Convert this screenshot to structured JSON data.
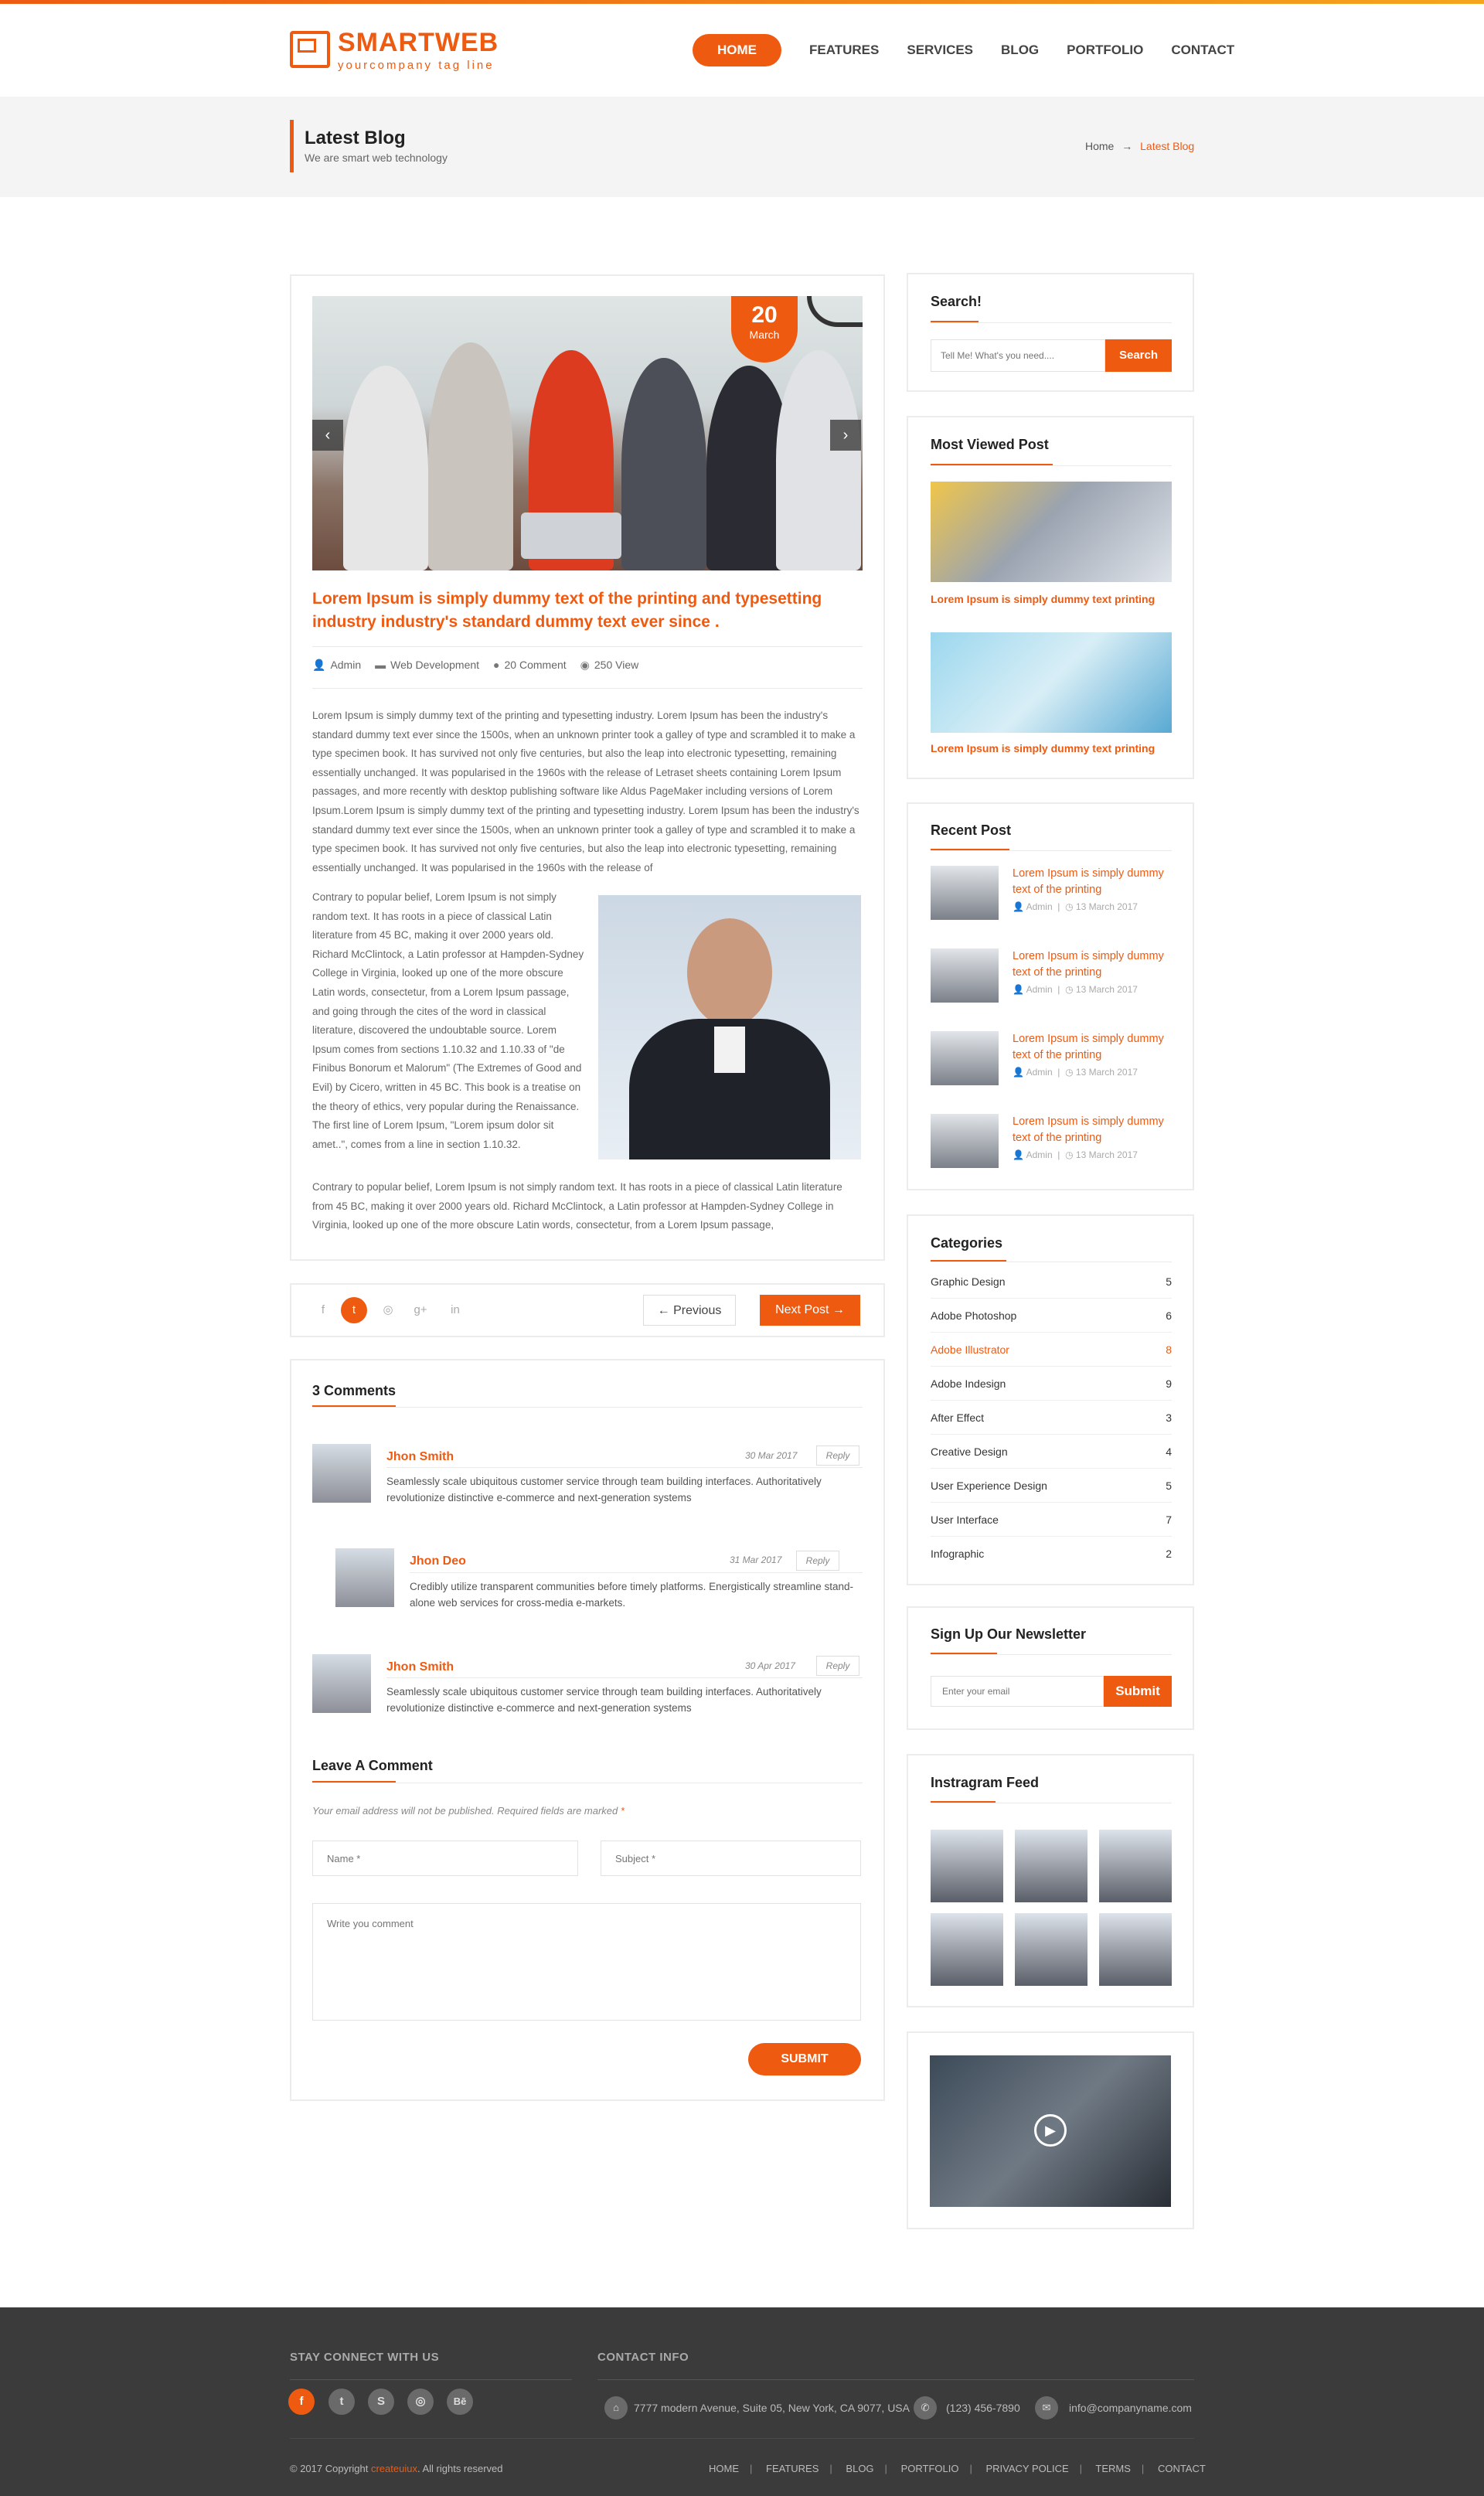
{
  "brand": {
    "name": "SMARTWEB",
    "tagline": "yourcompany tag line"
  },
  "nav": [
    "HOME",
    "FEATURES",
    "SERVICES",
    "BLOG",
    "PORTFOLIO",
    "CONTACT"
  ],
  "page": {
    "title": "Latest Blog",
    "subtitle": "We are smart web technology"
  },
  "breadcrumb": {
    "home": "Home",
    "current": "Latest Blog"
  },
  "post": {
    "date_day": "20",
    "date_month": "March",
    "title": "Lorem Ipsum is simply dummy text of the printing and typesetting industry industry's standard dummy text ever since .",
    "author": "Admin",
    "category": "Web Development",
    "comments": "20 Comment",
    "views": "250 View",
    "para1": "Lorem Ipsum is simply dummy text of the printing and typesetting industry. Lorem Ipsum has been the industry's standard dummy text ever since the 1500s, when an unknown printer took a galley of type and scrambled it to make a type specimen book. It has survived not only five centuries, but also the leap into electronic typesetting, remaining essentially unchanged. It was popularised in the 1960s with the release of Letraset sheets containing Lorem Ipsum passages, and more recently with desktop publishing software like Aldus PageMaker including versions of Lorem Ipsum.Lorem Ipsum is simply dummy text of the printing and typesetting industry. Lorem Ipsum has been the industry's standard dummy text ever since the 1500s, when an unknown printer took a galley of type and scrambled it to make a type specimen book. It has survived not only five centuries, but also the leap into electronic typesetting, remaining essentially unchanged. It was popularised in the 1960s with the release of",
    "para2": "Contrary to popular belief, Lorem Ipsum is not simply random text. It has roots in a piece of classical Latin literature from 45 BC, making it over 2000 years old. Richard McClintock, a Latin professor at Hampden-Sydney College in Virginia, looked up one of the more obscure Latin words, consectetur, from a Lorem Ipsum passage, and going through the cites of the word in classical literature, discovered the undoubtable source. Lorem Ipsum comes from sections 1.10.32 and 1.10.33 of \"de Finibus Bonorum et Malorum\" (The Extremes of Good and Evil) by Cicero, written in 45 BC. This book is a treatise on the theory of ethics, very popular during the Renaissance. The first line of Lorem Ipsum, \"Lorem ipsum dolor sit amet..\", comes from a line in section 1.10.32.",
    "para3": "Contrary to popular belief, Lorem Ipsum is not simply random text. It has roots in a piece of classical Latin literature from 45 BC, making it over 2000 years old. Richard McClintock, a Latin professor at Hampden-Sydney College in Virginia, looked up one of the more obscure Latin words, consectetur, from a Lorem Ipsum passage,"
  },
  "postnav": {
    "previous": "Previous",
    "next": "Next Post"
  },
  "comments": {
    "heading": "3 Comments",
    "items": [
      {
        "name": "Jhon Smith",
        "date": "30 Mar 2017",
        "reply": "Reply",
        "text": "Seamlessly scale ubiquitous customer service through team building interfaces. Authoritatively revolutionize distinctive e-commerce and next-generation systems"
      },
      {
        "name": "Jhon Deo",
        "date": "31 Mar 2017",
        "reply": "Reply",
        "text": "Credibly utilize transparent communities before timely platforms. Energistically streamline stand-alone web services for cross-media e-markets."
      },
      {
        "name": "Jhon Smith",
        "date": "30 Apr 2017",
        "reply": "Reply",
        "text": "Seamlessly scale ubiquitous customer service through team building interfaces. Authoritatively revolutionize distinctive e-commerce and next-generation systems"
      }
    ]
  },
  "leave": {
    "heading": "Leave A Comment",
    "note": "Your email address will not be published. Required fields are marked",
    "required_mark": "*",
    "name_ph": "Name *",
    "subject_ph": "Subject *",
    "comment_ph": "Write you comment",
    "submit": "SUBMIT"
  },
  "sidebar": {
    "search": {
      "heading": "Search!",
      "placeholder": "Tell Me! What's you need....",
      "button": "Search"
    },
    "most_viewed": {
      "heading": "Most Viewed Post",
      "items": [
        "Lorem Ipsum is simply dummy text printing",
        "Lorem Ipsum is simply dummy text  printing"
      ]
    },
    "recent": {
      "heading": "Recent Post",
      "items": [
        {
          "title": "Lorem Ipsum is simply dummy text of the printing",
          "author": "Admin",
          "date": "13 March 2017"
        },
        {
          "title": "Lorem Ipsum is simply dummy text of the printing",
          "author": "Admin",
          "date": "13 March 2017"
        },
        {
          "title": "Lorem Ipsum is simply dummy text of the printing",
          "author": "Admin",
          "date": "13 March 2017"
        },
        {
          "title": "Lorem Ipsum is simply dummy text of the printing",
          "author": "Admin",
          "date": "13 March 2017"
        }
      ]
    },
    "categories": {
      "heading": "Categories",
      "items": [
        {
          "name": "Graphic Design",
          "count": "5"
        },
        {
          "name": "Adobe Photoshop",
          "count": "6"
        },
        {
          "name": "Adobe Illustrator",
          "count": "8"
        },
        {
          "name": "Adobe Indesign",
          "count": "9"
        },
        {
          "name": "After Effect",
          "count": "3"
        },
        {
          "name": "Creative Design",
          "count": "4"
        },
        {
          "name": "User Experience Design",
          "count": "5"
        },
        {
          "name": "User Interface",
          "count": "7"
        },
        {
          "name": "Infographic",
          "count": "2"
        }
      ]
    },
    "newsletter": {
      "heading": "Sign Up Our Newsletter",
      "placeholder": "Enter your email",
      "button": "Submit"
    },
    "instagram": {
      "heading": "Instragram Feed"
    }
  },
  "footer": {
    "stay_heading": "STAY CONNECT WITH US",
    "contact_heading": "CONTACT INFO",
    "address": "7777 modern Avenue, Suite 05, New York, CA 9077, USA",
    "phone": "(123) 456-7890",
    "email": "info@companyname.com",
    "copyright_pre": "© 2017 Copyright",
    "copyright_brand": "createuiux",
    "copyright_post": ". All rights reserved",
    "links": [
      "HOME",
      "FEATURES",
      "BLOG",
      "PORTFOLIO",
      "PRIVACY POLICE",
      "TERMS",
      "CONTACT"
    ]
  },
  "colors": {
    "accent": "#ef5a11",
    "footer_bg": "#3b3b3b",
    "titlebar_bg": "#f4f4f4"
  }
}
